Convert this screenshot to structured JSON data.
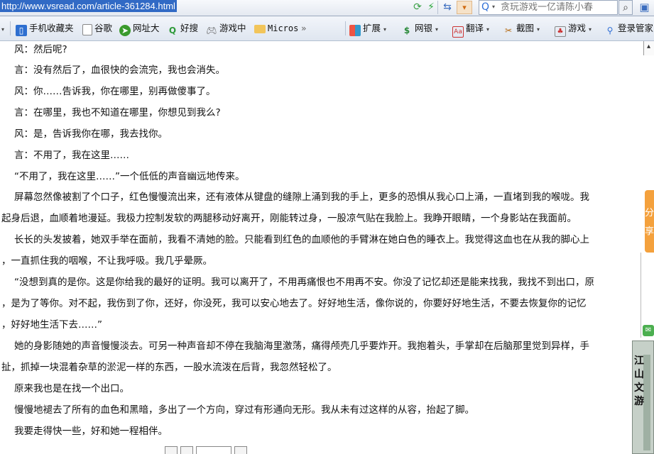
{
  "address_bar": {
    "url": "http://www.vsread.com/article-361284.html",
    "search_placeholder": "贪玩游戏一亿请陈小春"
  },
  "toolbar": {
    "bookmarks": [
      {
        "label": "手机收藏夹",
        "icon": "phone-icon"
      },
      {
        "label": "谷歌",
        "icon": "page-icon"
      },
      {
        "label": "网址大",
        "icon": "home-icon"
      },
      {
        "label": "好搜",
        "icon": "search-engine-icon"
      },
      {
        "label": "游戏中",
        "icon": "gamepad-icon"
      },
      {
        "label": "Micros",
        "icon": "folder-icon"
      }
    ],
    "more_glyph": "»",
    "tools": [
      {
        "label": "扩展",
        "icon": "extension-icon"
      },
      {
        "label": "网银",
        "icon": "bank-icon"
      },
      {
        "label": "翻译",
        "icon": "translate-icon"
      },
      {
        "label": "截图",
        "icon": "screenshot-icon"
      },
      {
        "label": "游戏",
        "icon": "game-icon"
      },
      {
        "label": "登录管家",
        "icon": "login-icon"
      }
    ]
  },
  "article": {
    "lines": [
      "风：然后呢?",
      "言：没有然后了，血很快的会流完，我也会消失。",
      "风：你……告诉我，你在哪里，别再做傻事了。",
      "言：在哪里，我也不知道在哪里，你想见到我么?",
      "风：是，告诉我你在哪，我去找你。",
      "言：不用了，我在这里……",
      "“不用了，我在这里……”一个低低的声音幽远地传来。",
      "屏幕忽然像被割了个口子，红色慢慢流出来，还有液体从键盘的缝隙上涌到我的手上，更多的恐惧从我心口上涌，一直堵到我的喉咙。我",
      "起身后退，血顺着地漫延。我极力控制发软的两腿移动好离开，刚能转过身，一股凉气贴在我脸上。我睁开眼睛，一个身影站在我面前。",
      "长长的头发披着，她双手举在面前，我看不清她的脸。只能看到红色的血顺他的手臂淋在她白色的睡衣上。我觉得这血也在从我的脚心上",
      "，一直抓住我的咽喉，不让我呼吸。我几乎晕厥。",
      "“没想到真的是你。这是你给我的最好的证明。我可以离开了，不用再痛恨也不用再不安。你没了记忆却还是能来找我，我找不到出口，原",
      "，是为了等你。对不起，我伤到了你，还好，你没死，我可以安心地去了。好好地生活，像你说的，你要好好地生活，不要去恢复你的记忆",
      "，好好地生活下去……”",
      "她的身影随她的声音慢慢淡去。可另一种声音却不停在我脑海里激荡，痛得颅壳几乎要炸开。我抱着头，手掌却在后脑那里觉到异样，手",
      "扯，抓掉一块混着杂草的淤泥一样的东西，一股水流泼在后背，我忽然轻松了。",
      "原来我也是在找一个出口。",
      "慢慢地褪去了所有的血色和黑暗，多出了一个方向，穿过有形通向无形。我从未有过这样的从容，抬起了脚。",
      "我要走得快一些，好和她一程相伴。"
    ]
  },
  "side": {
    "orange_tab_text": "分享",
    "ad_text": "江山文游"
  }
}
